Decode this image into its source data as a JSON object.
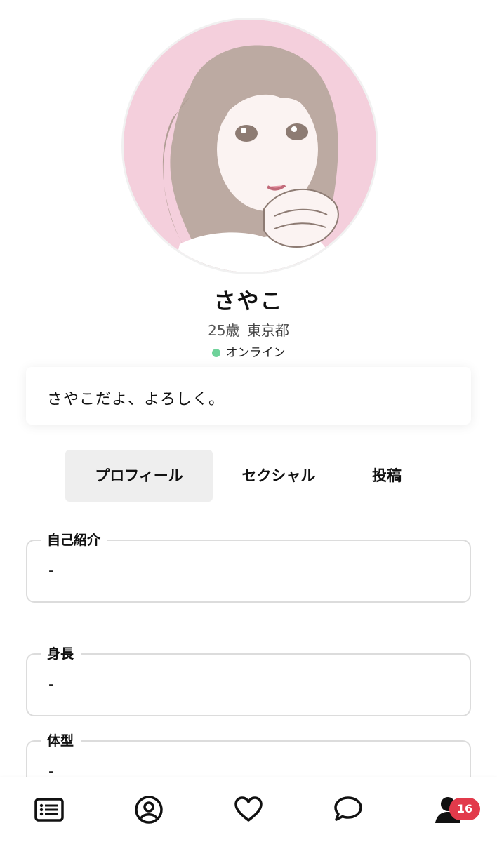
{
  "profile": {
    "name": "さやこ",
    "age": "25歳",
    "location": "東京都",
    "status": "オンライン",
    "status_color": "#6fd29a",
    "bio": "さやこだよ、よろしく。"
  },
  "tabs": [
    {
      "label": "プロフィール",
      "active": true
    },
    {
      "label": "セクシャル",
      "active": false
    },
    {
      "label": "投稿",
      "active": false
    }
  ],
  "fields": [
    {
      "label": "自己紹介",
      "value": "-"
    },
    {
      "label": "身長",
      "value": "-"
    },
    {
      "label": "体型",
      "value": "-"
    }
  ],
  "bottom_nav": {
    "items": [
      {
        "icon": "list-icon"
      },
      {
        "icon": "user-circle-icon"
      },
      {
        "icon": "heart-icon"
      },
      {
        "icon": "chat-bubble-icon"
      },
      {
        "icon": "person-icon"
      }
    ],
    "badge_count": "16",
    "badge_color": "#e23a4b"
  }
}
